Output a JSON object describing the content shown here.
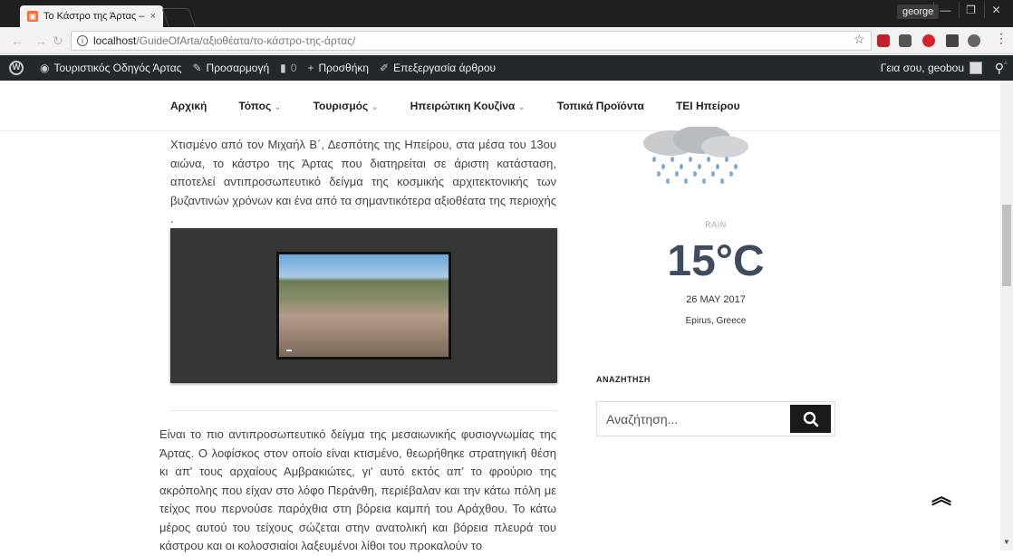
{
  "browser": {
    "tab_title": "Το Κάστρο της Άρτας –",
    "tab_close": "×",
    "profile_name": "george",
    "url_host": "localhost",
    "url_path": "/GuideOfArta/αξιοθέατα/το-κάστρο-της-άρτας/"
  },
  "wp_admin_bar": {
    "site_name": "Τουριστικός Οδηγός Άρτας",
    "customize": "Προσαρμογή",
    "comments_count": "0",
    "add_new": "Προσθήκη",
    "edit_post": "Επεξεργασία άρθρου",
    "greeting": "Γεια σου, geobou"
  },
  "nav": {
    "items": [
      {
        "label": "Αρχική",
        "has_dropdown": false
      },
      {
        "label": "Τόπος",
        "has_dropdown": true
      },
      {
        "label": "Τουρισμός",
        "has_dropdown": true
      },
      {
        "label": "Ηπειρώτικη Κουζίνα",
        "has_dropdown": true
      },
      {
        "label": "Τοπικά Προϊόντα",
        "has_dropdown": false
      },
      {
        "label": "ΤΕΙ Ηπείρου",
        "has_dropdown": false
      }
    ]
  },
  "content": {
    "paragraph1": "Χτισμένο από τον Μιχαήλ Β΄, Δεσπότης της Ηπείρου, στα μέσα του 13ου αιώνα, το κάστρο της Άρτας που διατηρείται σε άριστη κατάσταση, αποτελεί αντιπροσωπευτικό δείγμα της κοσμικής αρχιτεκτονικής των βυζαντινών χρόνων και ένα από τα σημαντικότερα αξιοθέατα της περιοχής .",
    "paragraph2": "Είναι το πιο αντιπροσωπευτικό δείγμα της μεσαιωνικής φυσιογνωμίας της Άρτας. Ο λοφίσκος στον οποίο είναι κτισμένο, θεωρήθηκε στρατηγική θέση κι απ' τους αρχαίους Αμβρακιώτες, γι' αυτό εκτός απ' το φρούριο της ακρόπολης που είχαν στο λόφο Περάνθη, περιέβαλαν και την κάτω πόλη με τείχος που περνούσε παρόχθια στη βόρεια καμπή του Αράχθου. Το κάτω μέρος αυτού του τείχους σώζεται στην ανατολική και βόρεια πλευρά του κάστρου και οι κολοσσιαίοι λαξευμένοι λίθοι του προκαλούν το"
  },
  "weather": {
    "condition": "RAIN",
    "temperature": "15°C",
    "date": "26 MAY 2017",
    "location": "Epirus, Greece"
  },
  "search_widget": {
    "heading": "ΑΝΑΖΗΤΗΣΗ",
    "placeholder": "Αναζήτηση..."
  },
  "colors": {
    "wp_bar": "#23282d",
    "temp_text": "#3e4c5e",
    "search_button": "#1a1a1a"
  }
}
